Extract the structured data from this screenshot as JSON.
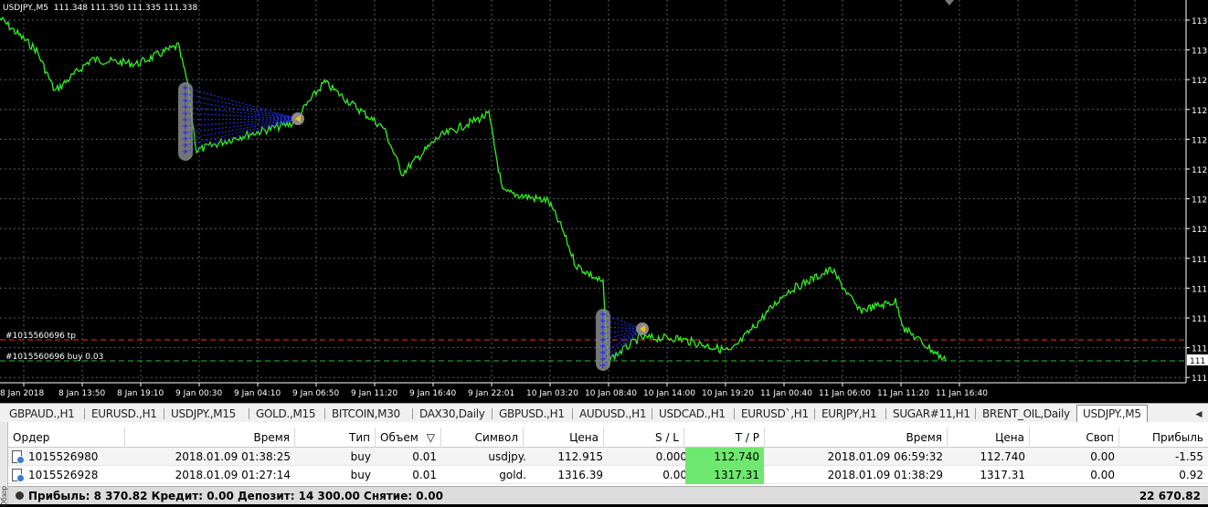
{
  "chart": {
    "header": "USDJPY.,M5  111.348 111.350 111.335 111.338",
    "price_axis_labels": [
      "113",
      "113",
      "112",
      "112",
      "112",
      "112",
      "112",
      "112",
      "111",
      "111",
      "111",
      "111",
      "111",
      "111"
    ],
    "current_price_label": "111",
    "time_axis_labels": [
      "8 Jan 2018",
      "8 Jan 13:50",
      "8 Jan 19:10",
      "9 Jan 00:30",
      "9 Jan 04:10",
      "9 Jan 06:50",
      "9 Jan 11:20",
      "9 Jan 16:40",
      "9 Jan 22:01",
      "10 Jan 03:20",
      "10 Jan 08:40",
      "10 Jan 14:00",
      "10 Jan 19:20",
      "11 Jan 00:40",
      "11 Jan 06:00",
      "11 Jan 11:20",
      "11 Jan 16:40"
    ],
    "tp_line_label": "#1015560696 tp",
    "buy_line_label": "#1015560696 buy 0.03",
    "colors": {
      "price_line": "#33ee22",
      "grid": "#5a5a5a",
      "tp_line": "#ff2a2a",
      "buy_line": "#22c522",
      "trade_lines": "#2233ff"
    }
  },
  "tabs": {
    "items": [
      "GBPAUD.,H1",
      "EURUSD.,H1",
      "USDJPY.,M15",
      "GOLD.,M15",
      "BITCOIN,M30",
      "DAX30,Daily",
      "GBPUSD.,H1",
      "AUDUSD.,H1",
      "USDCAD.,H1",
      "EURUSD`,H1",
      "EURJPY,H1",
      "SUGAR#11,H1",
      "BRENT_OIL,Daily",
      "USDJPY.,M5"
    ],
    "active": "USDJPY.,M5",
    "arrow": "◄"
  },
  "terminal": {
    "side_label": "Обзор",
    "columns": [
      "Ордер",
      "Время",
      "Тип",
      "Объем",
      "Символ",
      "Цена",
      "S / L",
      "T / P",
      "Время",
      "Цена",
      "Своп",
      "Прибыль"
    ],
    "sort_icon": "▽",
    "rows": [
      {
        "order": "1015526980",
        "time": "2018.01.09 01:38:25",
        "type": "buy",
        "volume": "0.01",
        "symbol": "usdjpy.",
        "price": "112.915",
        "sl": "0.000",
        "tp": "112.740",
        "close_time": "2018.01.09 06:59:32",
        "close_price": "112.740",
        "swap": "0.00",
        "profit": "-1.55"
      },
      {
        "order": "1015526928",
        "time": "2018.01.09 01:27:14",
        "type": "buy",
        "volume": "0.01",
        "symbol": "gold.",
        "price": "1316.39",
        "sl": "0.00",
        "tp": "1317.31",
        "close_time": "2018.01.09 01:38:29",
        "close_price": "1317.31",
        "swap": "0.00",
        "profit": "0.92"
      }
    ],
    "summary": "Прибыль: 8 370.82  Кредит: 0.00  Депозит: 14 300.00  Снятие: 0.00",
    "summary_total": "22 670.82"
  }
}
